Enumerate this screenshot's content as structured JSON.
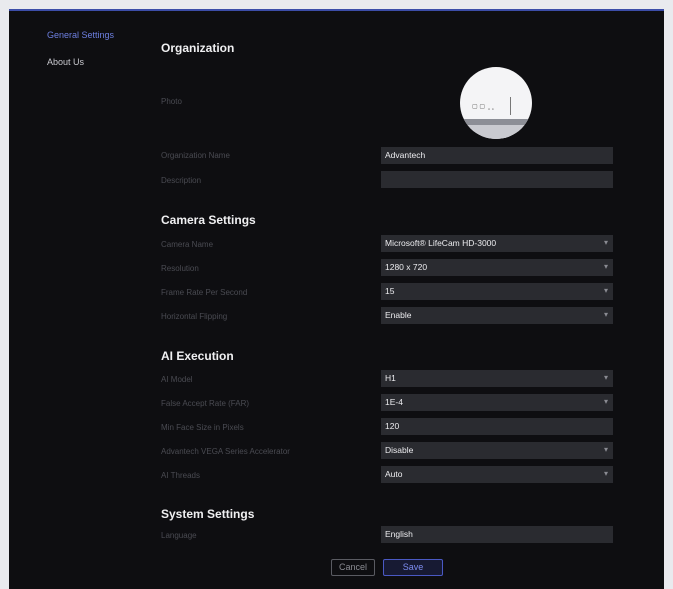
{
  "sidebar": {
    "items": [
      {
        "label": "General Settings",
        "active": true
      },
      {
        "label": "About Us",
        "active": false
      }
    ]
  },
  "organization": {
    "title": "Organization",
    "photo_label": "Photo",
    "name_label": "Organization Name",
    "name_value": "Advantech",
    "description_label": "Description",
    "description_value": ""
  },
  "camera": {
    "title": "Camera Settings",
    "camera_name_label": "Camera Name",
    "camera_name_value": "Microsoft® LifeCam HD-3000",
    "resolution_label": "Resolution",
    "resolution_value": "1280 x 720",
    "fps_label": "Frame Rate Per Second",
    "fps_value": "15",
    "flip_label": "Horizontal Flipping",
    "flip_value": "Enable"
  },
  "ai": {
    "title": "AI Execution",
    "model_label": "AI Model",
    "model_value": "H1",
    "far_label": "False Accept Rate (FAR)",
    "far_value": "1E-4",
    "min_face_label": "Min Face Size in Pixels",
    "min_face_value": "120",
    "accelerator_label": "Advantech VEGA Series Accelerator",
    "accelerator_value": "Disable",
    "threads_label": "AI Threads",
    "threads_value": "Auto"
  },
  "system": {
    "title": "System Settings",
    "language_label": "Language",
    "language_value": "English"
  },
  "actions": {
    "cancel_label": "Cancel",
    "save_label": "Save"
  },
  "icons": {
    "dropdown": "chevron-down-icon",
    "photo": "avatar-image"
  },
  "colors": {
    "accent": "#6d7fe0",
    "background": "#0e0e11",
    "field": "#2a2b30"
  }
}
